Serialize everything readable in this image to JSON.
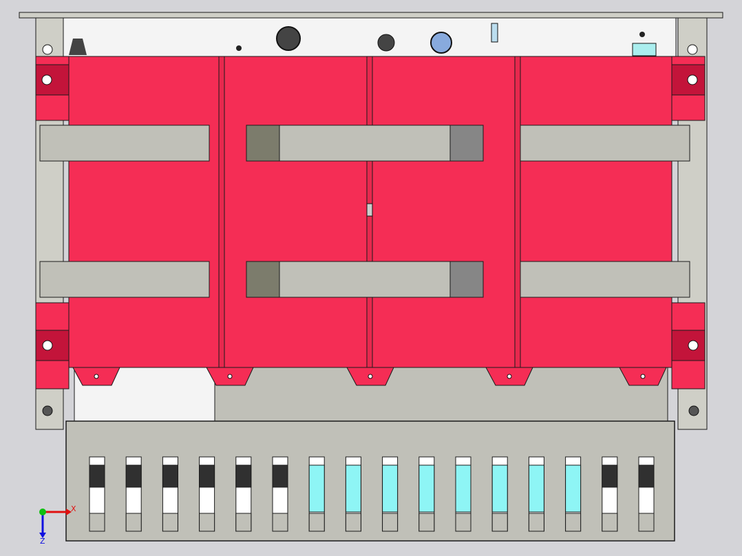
{
  "app": {
    "view": "cad-model-viewport",
    "background_color": "#d4d4d8"
  },
  "colors": {
    "red_panel": "#f52d55",
    "red_dark": "#c3143a",
    "bracket_gray": "#c0c0b8",
    "bracket_dark": "#7c7c6c",
    "bracket_darker": "#868686",
    "frame_gray": "#cfcfc7",
    "frame_white": "#f4f4f4",
    "slot_dark": "#303030",
    "slot_cyan": "#8ef5f5",
    "edge": "#1a1a1a"
  },
  "triad": {
    "x_label": "X",
    "z_label": "Z",
    "x_color": "#e01010",
    "y_color": "#10c010",
    "z_color": "#1010e0"
  },
  "icons": {
    "triad": "coordinate-triad-icon"
  },
  "vent_slots": [
    {
      "fill": "dark"
    },
    {
      "fill": "dark"
    },
    {
      "fill": "dark"
    },
    {
      "fill": "dark"
    },
    {
      "fill": "dark"
    },
    {
      "fill": "dark"
    },
    {
      "fill": "cyan"
    },
    {
      "fill": "cyan"
    },
    {
      "fill": "cyan"
    },
    {
      "fill": "cyan"
    },
    {
      "fill": "cyan"
    },
    {
      "fill": "cyan"
    },
    {
      "fill": "cyan"
    },
    {
      "fill": "cyan"
    },
    {
      "fill": "dark"
    },
    {
      "fill": "dark"
    }
  ]
}
